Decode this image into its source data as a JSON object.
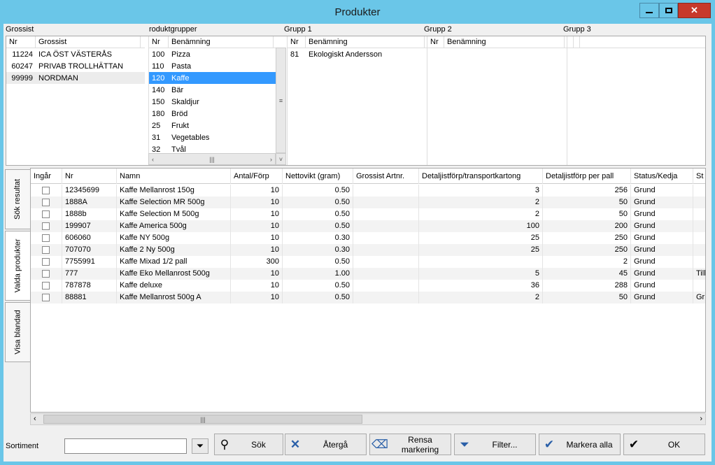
{
  "window": {
    "title": "Produkter"
  },
  "sections": {
    "grossist": "Grossist",
    "produktgrupper": "roduktgrupper",
    "grupp1": "Grupp 1",
    "grupp2": "Grupp 2",
    "grupp3": "Grupp 3"
  },
  "grossist_list": {
    "headers": [
      "Nr",
      "Grossist"
    ],
    "rows": [
      {
        "nr": "11224",
        "name": "ICA ÖST VÄSTERÅS"
      },
      {
        "nr": "60247",
        "name": "PRIVAB TROLLHÄTTAN"
      },
      {
        "nr": "99999",
        "name": "NORDMAN"
      }
    ]
  },
  "produktgrupp_list": {
    "headers": [
      "Nr",
      "Benämning"
    ],
    "rows": [
      {
        "nr": "100",
        "name": "Pizza"
      },
      {
        "nr": "110",
        "name": "Pasta"
      },
      {
        "nr": "120",
        "name": "Kaffe"
      },
      {
        "nr": "140",
        "name": "Bär"
      },
      {
        "nr": "150",
        "name": "Skaldjur"
      },
      {
        "nr": "180",
        "name": "Bröd"
      },
      {
        "nr": "25",
        "name": "Frukt"
      },
      {
        "nr": "31",
        "name": "Vegetables"
      },
      {
        "nr": "32",
        "name": "Tvål"
      }
    ]
  },
  "grupp1_list": {
    "headers": [
      "Nr",
      "Benämning"
    ],
    "rows": [
      {
        "nr": "81",
        "name": "Ekologiskt Andersson"
      }
    ]
  },
  "grupp2_list": {
    "headers": [
      "Nr",
      "Benämning"
    ]
  },
  "tabs": [
    "Sök resultat",
    "Valda produkter",
    "Visa blandad"
  ],
  "grid": {
    "headers": [
      "Ingår",
      "Nr",
      "Namn",
      "Antal/Förp",
      "Nettovikt (gram)",
      "Grossist Artnr.",
      "Detaljistförp/transportkartong",
      "Detaljistförp per pall",
      "Status/Kedja",
      "St"
    ],
    "rows": [
      {
        "nr": "12345699",
        "namn": "Kaffe Mellanrost 150g",
        "antal": "10",
        "vikt": "0.50",
        "artnr": "",
        "dtk": "3",
        "pall": "256",
        "status": "Grund",
        "st": ""
      },
      {
        "nr": "1888A",
        "namn": "Kaffe Selection MR 500g",
        "antal": "10",
        "vikt": "0.50",
        "artnr": "",
        "dtk": "2",
        "pall": "50",
        "status": "Grund",
        "st": ""
      },
      {
        "nr": "1888b",
        "namn": "Kaffe Selection M 500g",
        "antal": "10",
        "vikt": "0.50",
        "artnr": "",
        "dtk": "2",
        "pall": "50",
        "status": "Grund",
        "st": ""
      },
      {
        "nr": "199907",
        "namn": "Kaffe America 500g",
        "antal": "10",
        "vikt": "0.50",
        "artnr": "",
        "dtk": "100",
        "pall": "200",
        "status": "Grund",
        "st": ""
      },
      {
        "nr": "606060",
        "namn": "Kaffe NY 500g",
        "antal": "10",
        "vikt": "0.30",
        "artnr": "",
        "dtk": "25",
        "pall": "250",
        "status": "Grund",
        "st": ""
      },
      {
        "nr": "707070",
        "namn": "Kaffe 2 Ny 500g",
        "antal": "10",
        "vikt": "0.30",
        "artnr": "",
        "dtk": "25",
        "pall": "250",
        "status": "Grund",
        "st": ""
      },
      {
        "nr": "7755991",
        "namn": "Kaffe Mixad 1/2 pall",
        "antal": "300",
        "vikt": "0.50",
        "artnr": "",
        "dtk": "",
        "pall": "2",
        "status": "Grund",
        "st": ""
      },
      {
        "nr": "777",
        "namn": "Kaffe Eko Mellanrost 500g",
        "antal": "10",
        "vikt": "1.00",
        "artnr": "",
        "dtk": "5",
        "pall": "45",
        "status": "Grund",
        "st": "Till"
      },
      {
        "nr": "787878",
        "namn": "Kaffe deluxe",
        "antal": "10",
        "vikt": "0.50",
        "artnr": "",
        "dtk": "36",
        "pall": "288",
        "status": "Grund",
        "st": ""
      },
      {
        "nr": "88881",
        "namn": "Kaffe Mellanrost 500g A",
        "antal": "10",
        "vikt": "0.50",
        "artnr": "",
        "dtk": "2",
        "pall": "50",
        "status": "Grund",
        "st": "Gr"
      }
    ]
  },
  "bottom": {
    "sortiment_label": "Sortiment",
    "sortiment_value": "",
    "buttons": {
      "sok": "Sök",
      "atergå": "Återgå",
      "rensa": "Rensa markering",
      "filter": "Filter...",
      "markera": "Markera alla",
      "ok": "OK"
    }
  }
}
